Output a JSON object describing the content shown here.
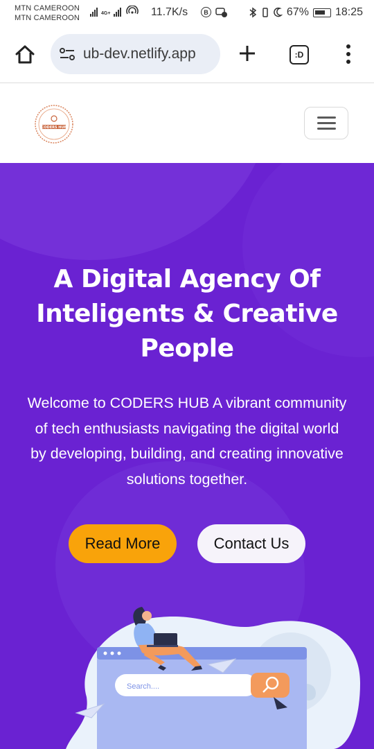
{
  "status_bar": {
    "carrier1": "MTN CAMEROON",
    "carrier2": "MTN CAMEROON",
    "network_type": "4G+",
    "speed": "11.7K/s",
    "battery": "67%",
    "time": "18:25"
  },
  "browser": {
    "url": "ub-dev.netlify.app",
    "tabs_label": ":D"
  },
  "site": {
    "logo_text": "CODERS HUB"
  },
  "hero": {
    "title_line1": "A Digital Agency Of",
    "title_line2": "Inteligents & Creative",
    "title_line3": "People",
    "text_line1": "Welcome to CODERS HUB A vibrant community",
    "text_line2": "of tech enthusiasts navigating the digital world",
    "text_line3": "by developing, building, and creating innovative",
    "text_line4": "solutions together.",
    "read_more": "Read More",
    "contact_us": "Contact Us",
    "search_placeholder": "Search...."
  },
  "colors": {
    "hero_bg": "#6a22d2",
    "accent_orange": "#f9a30a",
    "button_light": "#f6f3fa"
  }
}
